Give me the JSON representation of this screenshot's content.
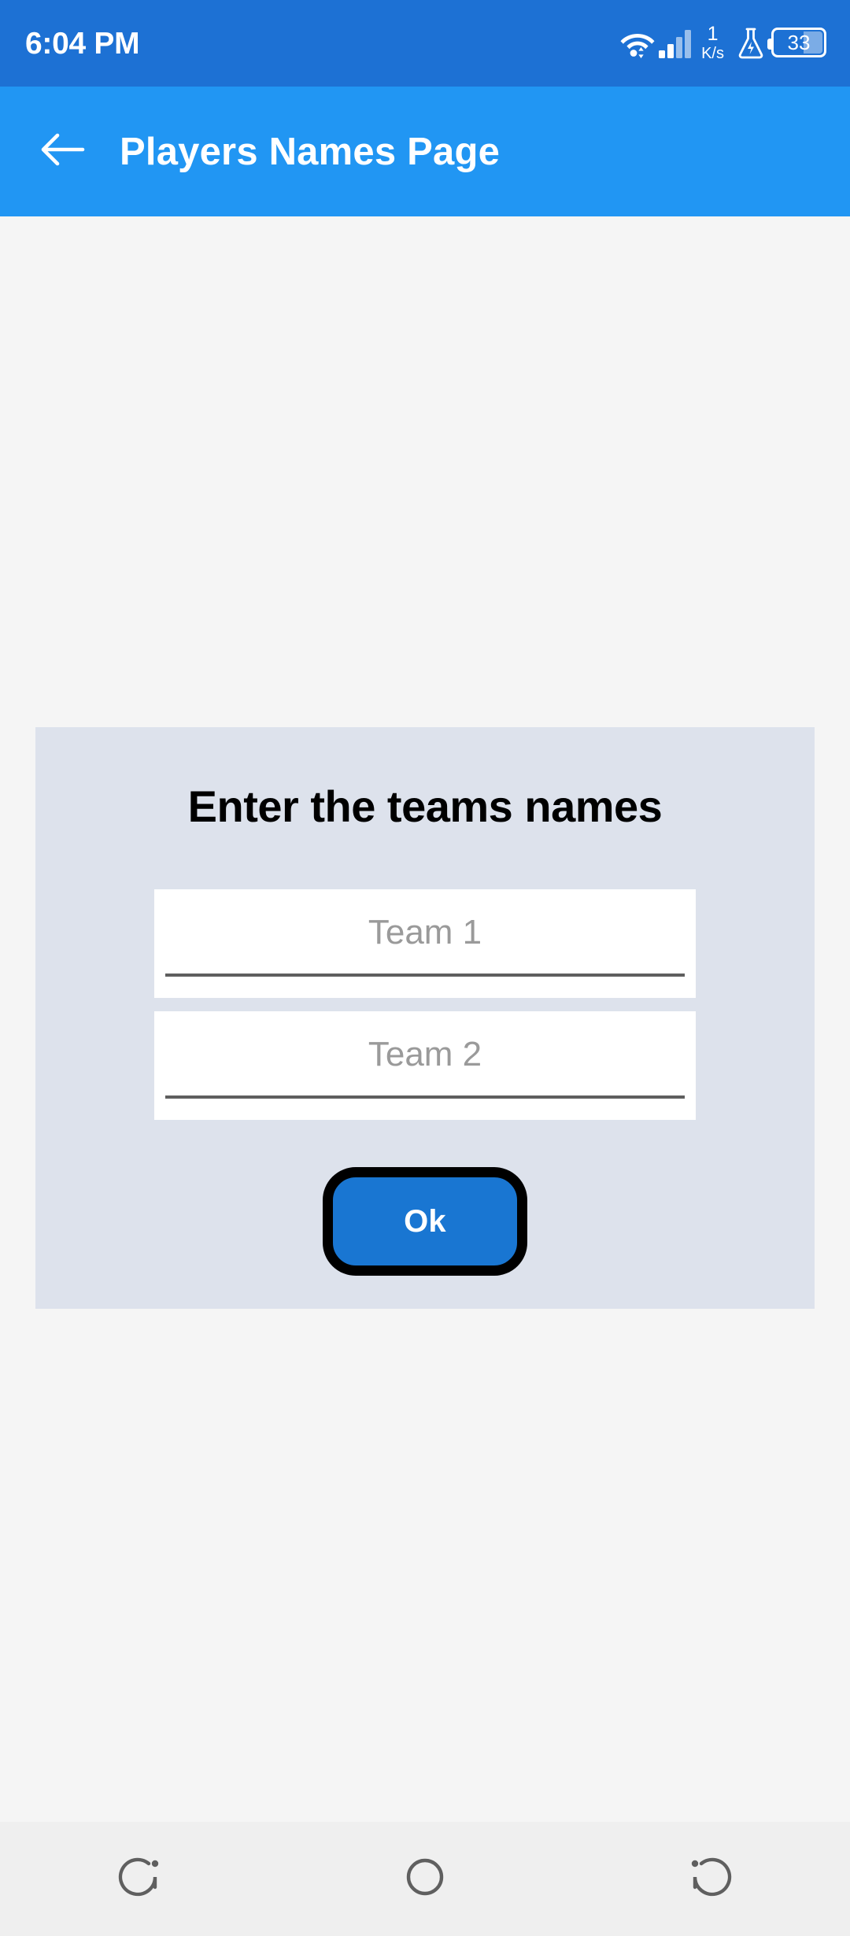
{
  "status_bar": {
    "clock": "6:04 PM",
    "network_speed_value": "1",
    "network_speed_unit": "K/s",
    "battery_level": "33",
    "icons": {
      "wifi": "wifi-icon",
      "signal": "cellular-signal-icon",
      "flask": "flask-icon",
      "battery": "battery-icon"
    },
    "background_color": "#1d71d4",
    "foreground_color": "#ffffff"
  },
  "app_bar": {
    "title": "Players Names Page",
    "back_icon": "arrow-left-icon",
    "background_color": "#2196f3",
    "title_color": "#ffffff"
  },
  "dialog": {
    "title": "Enter the teams names",
    "background_color": "#dde2ec",
    "title_color": "#000000",
    "fields": [
      {
        "name": "team-1",
        "placeholder": "Team 1",
        "value": "",
        "background_color": "#ffffff",
        "placeholder_color": "#9a9a9a",
        "underline_color": "#5e5e5e"
      },
      {
        "name": "team-2",
        "placeholder": "Team 2",
        "value": "",
        "background_color": "#ffffff",
        "placeholder_color": "#9a9a9a",
        "underline_color": "#5e5e5e"
      }
    ],
    "ok_button": {
      "label": "Ok",
      "fill_color": "#1976d2",
      "border_color": "#000000",
      "text_color": "#ffffff"
    }
  },
  "page": {
    "background_color": "#f5f5f5"
  },
  "nav_bar": {
    "background_color": "#efefef",
    "icon_color": "#5f5f5f",
    "buttons": [
      {
        "name": "recents",
        "icon": "recents-icon"
      },
      {
        "name": "home",
        "icon": "home-circle-icon"
      },
      {
        "name": "back",
        "icon": "back-icon"
      }
    ]
  }
}
